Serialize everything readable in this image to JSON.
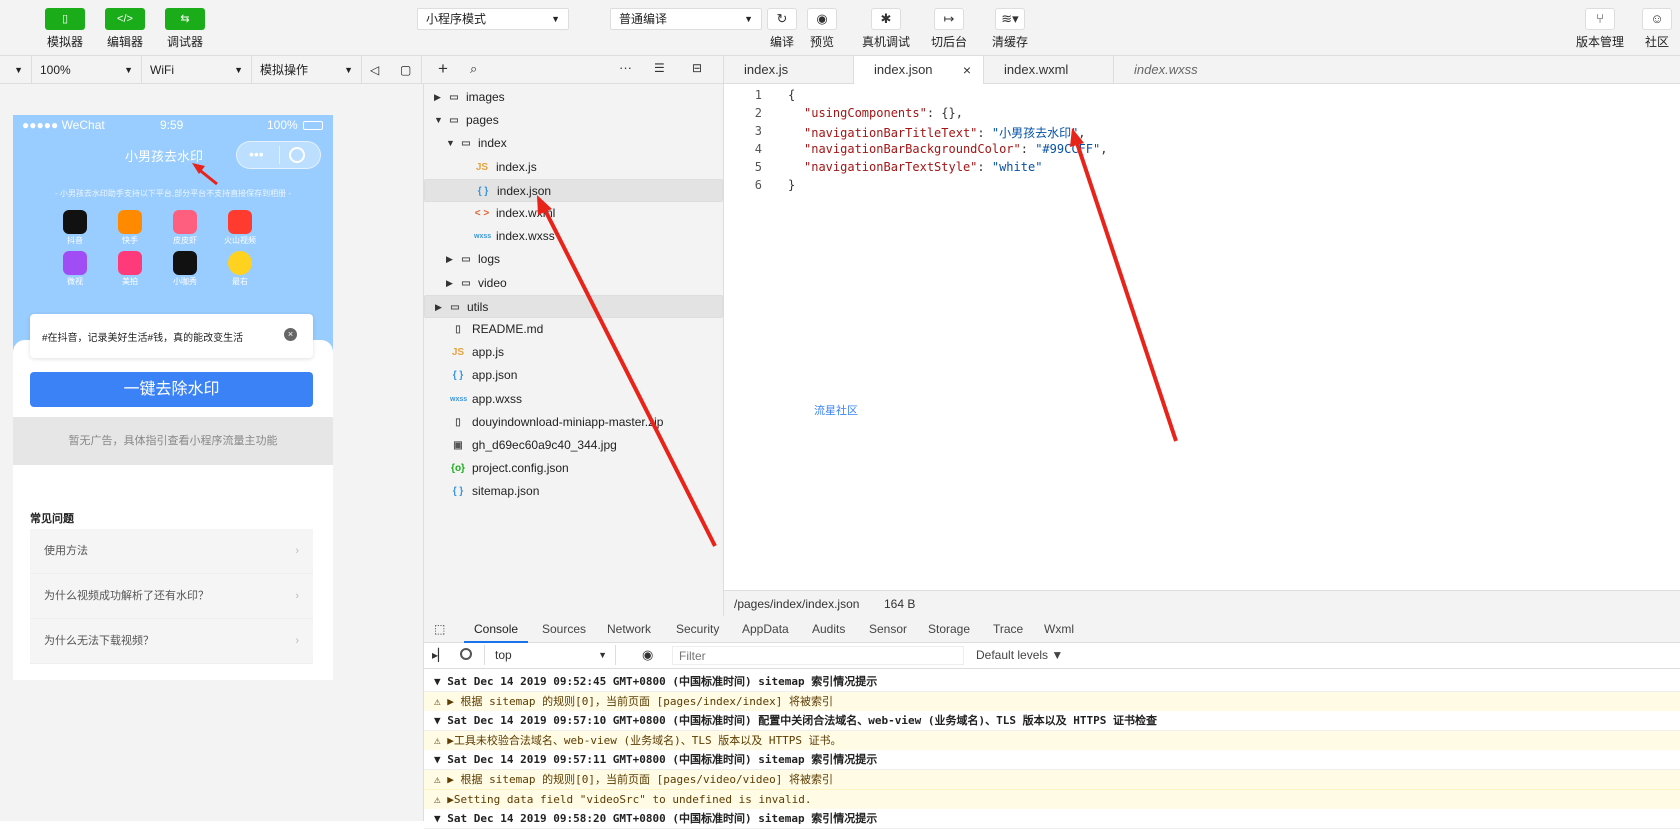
{
  "toolbar": {
    "left_buttons": [
      {
        "label": "模拟器",
        "icon": "phone-icon"
      },
      {
        "label": "编辑器",
        "icon": "code-icon"
      },
      {
        "label": "调试器",
        "icon": "debug-icon"
      }
    ],
    "mode_select": "小程序模式",
    "compile_select": "普通编译",
    "actions": [
      {
        "label": "编译",
        "icon": "refresh-icon"
      },
      {
        "label": "预览",
        "icon": "eye-icon"
      },
      {
        "label": "真机调试",
        "icon": "bug-icon"
      },
      {
        "label": "切后台",
        "icon": "switch-icon"
      },
      {
        "label": "清缓存",
        "icon": "layers-icon"
      }
    ],
    "right_actions": [
      {
        "label": "版本管理",
        "icon": "branch-icon"
      },
      {
        "label": "社区",
        "icon": "chat-icon"
      }
    ]
  },
  "sim_bar": {
    "zoom": "100%",
    "network": "WiFi",
    "operation": "模拟操作"
  },
  "phone": {
    "carrier": "●●●●● WeChat",
    "time": "9:59",
    "battery": "100%",
    "nav_title": "小男孩去水印",
    "hint": "- 小男孩去水印助手支持以下平台,部分平台不支持直接保存到相册 -",
    "apps": [
      {
        "name": "抖音",
        "color": "#111111"
      },
      {
        "name": "快手",
        "color": "#ff8a00"
      },
      {
        "name": "皮皮虾",
        "color": "#ff5f7e"
      },
      {
        "name": "火山视频",
        "color": "#ff3b30"
      },
      {
        "name": "微视",
        "color": "#a04df5"
      },
      {
        "name": "美拍",
        "color": "#ff3a7a"
      },
      {
        "name": "小咖秀",
        "color": "#111111"
      },
      {
        "name": "最右",
        "color": "#ffd21f"
      }
    ],
    "input_value": "#在抖音，记录美好生活#钱，真的能改变生活",
    "main_button": "一键去除水印",
    "ad_text": "暂无广告，具体指引查看小程序流量主功能",
    "faq_title": "常见问题",
    "faqs": [
      "使用方法",
      "为什么视频成功解析了还有水印？",
      "为什么无法下载视频？"
    ]
  },
  "tree": {
    "nodes": [
      {
        "name": "images",
        "type": "folder",
        "expanded": false,
        "level": 0
      },
      {
        "name": "pages",
        "type": "folder",
        "expanded": true,
        "level": 0
      },
      {
        "name": "index",
        "type": "folder",
        "expanded": true,
        "level": 1
      },
      {
        "name": "index.js",
        "type": "js",
        "level": 2
      },
      {
        "name": "index.json",
        "type": "json",
        "level": 2,
        "selected": true
      },
      {
        "name": "index.wxml",
        "type": "wxml",
        "level": 2
      },
      {
        "name": "index.wxss",
        "type": "wxss",
        "level": 2
      },
      {
        "name": "logs",
        "type": "folder",
        "expanded": false,
        "level": 1
      },
      {
        "name": "video",
        "type": "folder",
        "expanded": false,
        "level": 1
      },
      {
        "name": "utils",
        "type": "folder",
        "expanded": false,
        "level": 0,
        "hover": true
      },
      {
        "name": "README.md",
        "type": "file",
        "level": 0
      },
      {
        "name": "app.js",
        "type": "js",
        "level": 0
      },
      {
        "name": "app.json",
        "type": "json",
        "level": 0
      },
      {
        "name": "app.wxss",
        "type": "wxss",
        "level": 0
      },
      {
        "name": "douyindownload-miniapp-master.zip",
        "type": "file",
        "level": 0
      },
      {
        "name": "gh_d69ec60a9c40_344.jpg",
        "type": "image",
        "level": 0
      },
      {
        "name": "project.config.json",
        "type": "config",
        "level": 0
      },
      {
        "name": "sitemap.json",
        "type": "json",
        "level": 0
      }
    ]
  },
  "editor": {
    "tabs": [
      {
        "label": "index.js",
        "active": false
      },
      {
        "label": "index.json",
        "active": true
      },
      {
        "label": "index.wxml",
        "active": false
      },
      {
        "label": "index.wxss",
        "active": false,
        "italic": true
      }
    ],
    "lines": [
      {
        "n": "1",
        "text": "{"
      },
      {
        "n": "2",
        "key": "\"usingComponents\"",
        "sep": ": ",
        "val": "{}",
        "end": ","
      },
      {
        "n": "3",
        "key": "\"navigationBarTitleText\"",
        "sep": ": ",
        "val": "\"小男孩去水印\"",
        "end": ","
      },
      {
        "n": "4",
        "key": "\"navigationBarBackgroundColor\"",
        "sep": ": ",
        "val": "\"#99CCFF\"",
        "end": ","
      },
      {
        "n": "5",
        "key": "\"navigationBarTextStyle\"",
        "sep": ": ",
        "val": "\"white\"",
        "end": ""
      },
      {
        "n": "6",
        "text": "}"
      }
    ],
    "watermark": "流星社区",
    "status_path": "/pages/index/index.json",
    "status_size": "164 B"
  },
  "devtools": {
    "tabs": [
      "Console",
      "Sources",
      "Network",
      "Security",
      "AppData",
      "Audits",
      "Sensor",
      "Storage",
      "Trace",
      "Wxml"
    ],
    "context": "top",
    "filter_placeholder": "Filter",
    "levels": "Default levels ▼",
    "logs": [
      {
        "kind": "grp",
        "text": "▼ Sat Dec 14 2019 09:52:45 GMT+0800 (中国标准时间) sitemap 索引情况提示"
      },
      {
        "kind": "warn",
        "text": "  ⚠ ▶ 根据 sitemap 的规则[0]，当前页面 [pages/index/index] 将被索引"
      },
      {
        "kind": "grp",
        "text": "▼ Sat Dec 14 2019 09:57:10 GMT+0800 (中国标准时间) 配置中关闭合法域名、web-view (业务域名)、TLS 版本以及 HTTPS 证书检查"
      },
      {
        "kind": "warn",
        "text": "  ⚠ ▶工具未校验合法域名、web-view (业务域名)、TLS 版本以及 HTTPS 证书。"
      },
      {
        "kind": "grp",
        "text": "▼ Sat Dec 14 2019 09:57:11 GMT+0800 (中国标准时间) sitemap 索引情况提示"
      },
      {
        "kind": "warn",
        "text": "  ⚠ ▶ 根据 sitemap 的规则[0]，当前页面 [pages/video/video] 将被索引"
      },
      {
        "kind": "warn",
        "text": "⚠ ▶Setting data field \"videoSrc\" to undefined is invalid."
      },
      {
        "kind": "grp",
        "text": "▼ Sat Dec 14 2019 09:58:20 GMT+0800 (中国标准时间) sitemap 索引情况提示"
      }
    ]
  },
  "colors": {
    "accent_green": "#1aad19",
    "nav_blue": "#99ccff",
    "button_blue": "#3b82f6",
    "annotation_red": "#e8231a"
  }
}
